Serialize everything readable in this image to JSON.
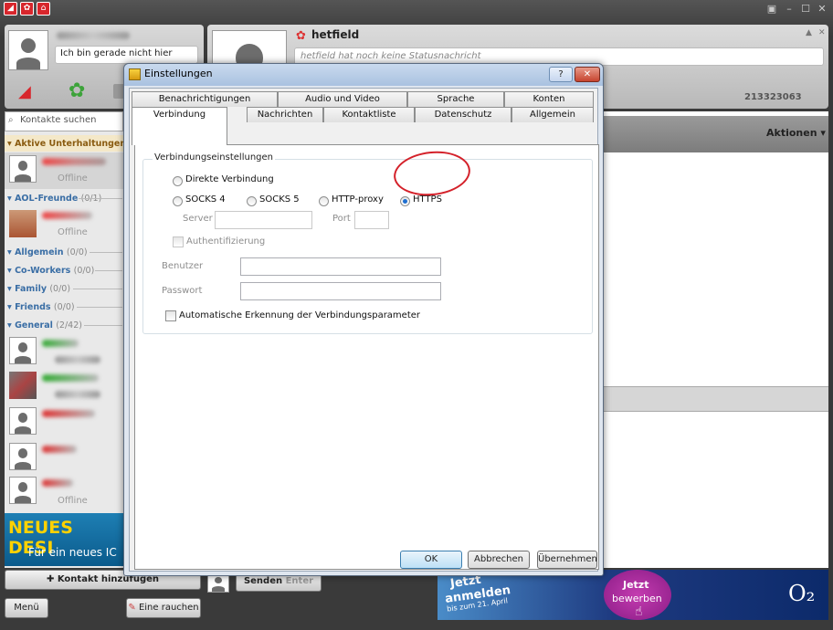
{
  "topbar": {
    "icons": [
      "prosieben-icon",
      "icq-icon",
      "home-icon"
    ]
  },
  "profile": {
    "status_message": "Ich bin gerade nicht hier"
  },
  "contact_header": {
    "name": "hetfield",
    "status_placeholder": "hetfield hat noch keine Statusnachricht",
    "uin": "213323063"
  },
  "search": {
    "placeholder": "Kontakte suchen"
  },
  "groups": [
    {
      "name": "Aktive Unterhaltungen",
      "count": "(0"
    },
    {
      "name": "AOL-Freunde",
      "count": "(0/1)"
    },
    {
      "name": "Allgemein",
      "count": "(0/0)"
    },
    {
      "name": "Co-Workers",
      "count": "(0/0)"
    },
    {
      "name": "Family",
      "count": "(0/0)"
    },
    {
      "name": "Friends",
      "count": "(0/0)"
    },
    {
      "name": "General",
      "count": "(2/42)"
    }
  ],
  "contact_status": {
    "offline": "Offline"
  },
  "banner": {
    "line1": "NEUES DESI",
    "line2": "Für ein neues IC"
  },
  "bottom": {
    "add_contact": "Kontakt hinzufügen",
    "send": "Senden",
    "enter": "Enter",
    "menu": "Menü",
    "smoke": "Eine rauchen"
  },
  "right": {
    "actions": "Aktionen"
  },
  "ad": {
    "jetzt_anmelden": "Jetzt",
    "anmelden": "anmelden",
    "date": "bis zum 21. April",
    "jetzt": "Jetzt",
    "bewerben": "bewerben",
    "brand": "O₂"
  },
  "dialog": {
    "title": "Einstellungen",
    "tabs_row1": [
      "Benachrichtigungen",
      "Audio und Video",
      "Sprache",
      "Konten"
    ],
    "tabs_row2": [
      "Verbindung",
      "Nachrichten",
      "Kontaktliste",
      "Datenschutz",
      "Allgemein"
    ],
    "group_title": "Verbindungseinstellungen",
    "direct": "Direkte Verbindung",
    "socks4": "SOCKS 4",
    "socks5": "SOCKS 5",
    "http_proxy": "HTTP-proxy",
    "https": "HTTPS",
    "server": "Server",
    "port": "Port",
    "auth": "Authentifizierung",
    "user": "Benutzer",
    "password": "Passwort",
    "auto_detect": "Automatische Erkennung der Verbindungsparameter",
    "ok": "OK",
    "cancel": "Abbrechen",
    "apply": "Übernehmen",
    "selected": "HTTPS"
  }
}
